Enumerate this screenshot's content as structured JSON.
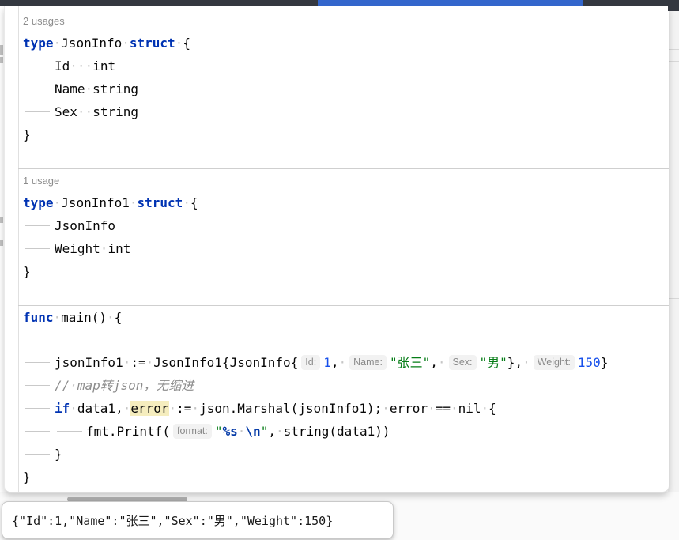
{
  "palette": {
    "chrome_dark": "#343840",
    "chrome_active_blue": "#3366cc",
    "keyword_blue": "#0033b3",
    "string_green": "#067d17",
    "number_blue": "#1750eb",
    "comment_gray": "#8c8c8c",
    "escape_blue": "#0037a6",
    "identifier_highlight": "#f5edbe",
    "inlay_hint_bg": "#f2f2f2",
    "separator_gray": "#cfcfcf"
  },
  "editor": {
    "rows": [
      {
        "k": "label",
        "t": "2 usages"
      },
      {
        "k": "c",
        "segs": [
          [
            "kw",
            "type"
          ],
          [
            "pl",
            " JsonInfo "
          ],
          [
            "kw",
            "struct"
          ],
          [
            "pl",
            " {"
          ]
        ]
      },
      {
        "k": "c",
        "tabs": 1,
        "segs": [
          [
            "pl",
            "Id   int"
          ]
        ]
      },
      {
        "k": "c",
        "tabs": 1,
        "segs": [
          [
            "pl",
            "Name string"
          ]
        ]
      },
      {
        "k": "c",
        "tabs": 1,
        "segs": [
          [
            "pl",
            "Sex  string"
          ]
        ]
      },
      {
        "k": "c",
        "segs": [
          [
            "pl",
            "}"
          ]
        ]
      },
      {
        "k": "blank"
      },
      {
        "k": "sep"
      },
      {
        "k": "label",
        "t": "1 usage"
      },
      {
        "k": "c",
        "segs": [
          [
            "kw",
            "type"
          ],
          [
            "pl",
            " JsonInfo1 "
          ],
          [
            "kw",
            "struct"
          ],
          [
            "pl",
            " {"
          ]
        ]
      },
      {
        "k": "c",
        "tabs": 1,
        "segs": [
          [
            "pl",
            "JsonInfo"
          ]
        ]
      },
      {
        "k": "c",
        "tabs": 1,
        "segs": [
          [
            "pl",
            "Weight int"
          ]
        ]
      },
      {
        "k": "c",
        "segs": [
          [
            "pl",
            "}"
          ]
        ]
      },
      {
        "k": "blank"
      },
      {
        "k": "sep"
      },
      {
        "k": "c",
        "segs": [
          [
            "kw",
            "func"
          ],
          [
            "pl",
            " main() {"
          ]
        ]
      },
      {
        "k": "blank"
      },
      {
        "k": "c",
        "tabs": 1,
        "segs": [
          [
            "pl",
            "jsonInfo1 := JsonInfo1{JsonInfo{"
          ],
          [
            "hint",
            "Id:"
          ],
          [
            "num",
            "1"
          ],
          [
            "pl",
            ", "
          ],
          [
            "hint",
            "Name:"
          ],
          [
            "str",
            "\"张三\""
          ],
          [
            "pl",
            ", "
          ],
          [
            "hint",
            "Sex:"
          ],
          [
            "str",
            "\"男\""
          ],
          [
            "pl",
            "}, "
          ],
          [
            "hint",
            "Weight:"
          ],
          [
            "num",
            "150"
          ],
          [
            "pl",
            "}"
          ]
        ]
      },
      {
        "k": "c",
        "tabs": 1,
        "segs": [
          [
            "cmt",
            "// map转json，无缩进"
          ]
        ]
      },
      {
        "k": "c",
        "tabs": 1,
        "segs": [
          [
            "kw",
            "if"
          ],
          [
            "pl",
            " data1, "
          ],
          [
            "hl",
            "error"
          ],
          [
            "pl",
            " := json.Marshal(jsonInfo1); error == nil {"
          ]
        ]
      },
      {
        "k": "c",
        "tabs": 2,
        "guide": true,
        "segs": [
          [
            "pl",
            "fmt.Printf("
          ],
          [
            "hint",
            "format:"
          ],
          [
            "str",
            "\""
          ],
          [
            "esc",
            "%s"
          ],
          [
            "str",
            " "
          ],
          [
            "esc",
            "\\n"
          ],
          [
            "str",
            "\""
          ],
          [
            "pl",
            ", string(data1))"
          ]
        ]
      },
      {
        "k": "c",
        "tabs": 1,
        "segs": [
          [
            "pl",
            "}"
          ]
        ]
      },
      {
        "k": "c",
        "segs": [
          [
            "pl",
            "}"
          ]
        ]
      }
    ]
  },
  "popup": {
    "text": "{\"Id\":1,\"Name\":\"张三\",\"Sex\":\"男\",\"Weight\":150}"
  }
}
